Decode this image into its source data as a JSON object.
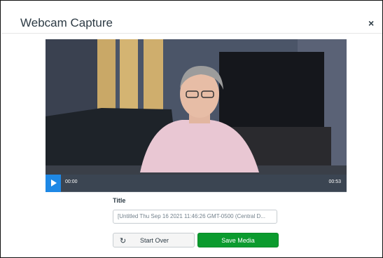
{
  "dialog": {
    "title": "Webcam Capture",
    "close_icon": "×"
  },
  "player": {
    "current_time": "00:00",
    "duration": "00:53",
    "play_icon": "play-icon"
  },
  "form": {
    "title_label": "Title",
    "title_value": "[Untitled Thu Sep 16 2021 11:46:26 GMT-0500 (Central D..."
  },
  "buttons": {
    "start_over_label": "Start Over",
    "start_over_icon": "↻",
    "save_label": "Save Media"
  },
  "colors": {
    "save_button": "#0b9b2e",
    "play_button": "#1e88e5",
    "text": "#2d3b45"
  }
}
